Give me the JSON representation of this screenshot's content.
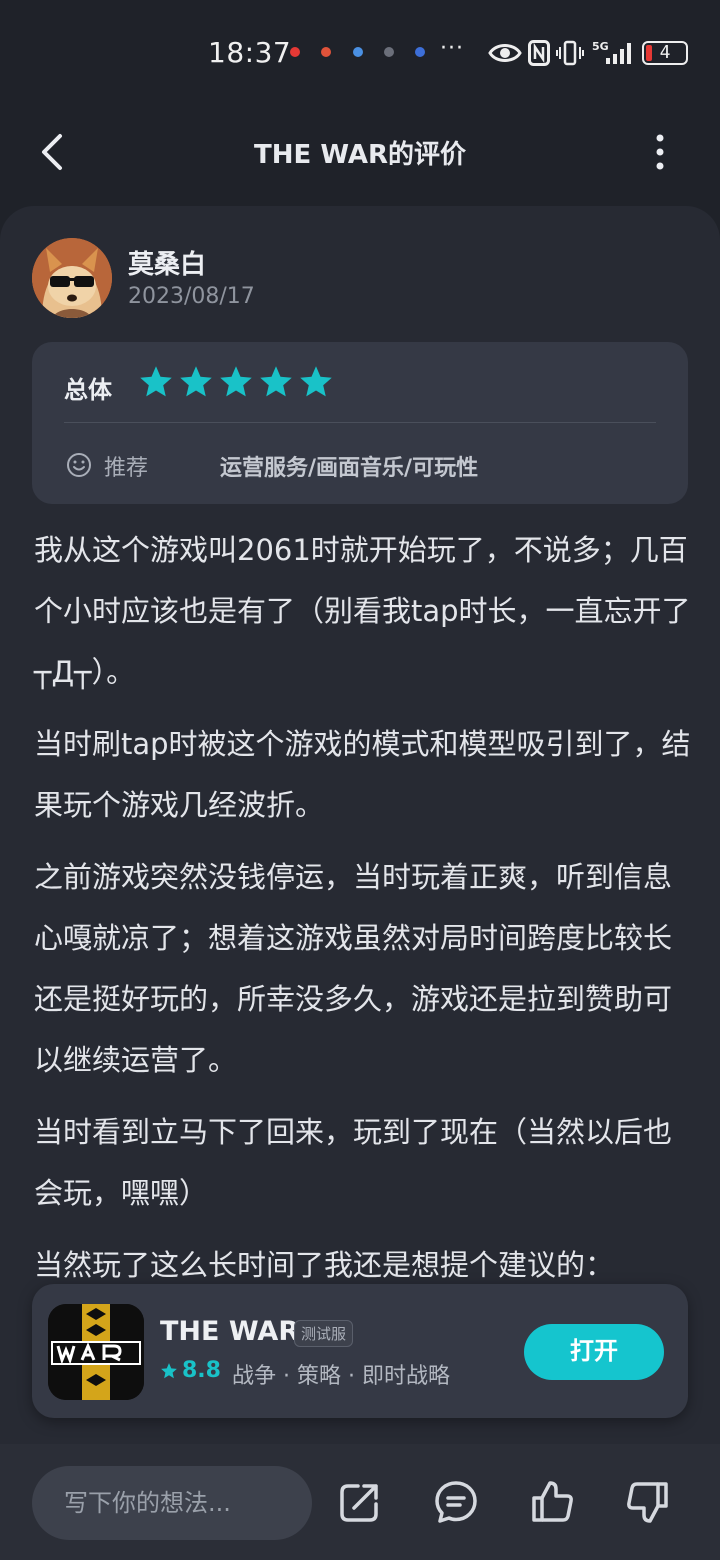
{
  "status_bar": {
    "time": "18:37",
    "more": "···",
    "battery": "4",
    "network": "5G",
    "notification_colors": [
      "#e53935",
      "#e0533a",
      "#4a90e2",
      "#6b6f7a",
      "#3d6fd8"
    ]
  },
  "header": {
    "title": "THE WAR的评价"
  },
  "review": {
    "user_name": "莫桑白",
    "date": "2023/08/17",
    "rating": {
      "overall_label": "总体",
      "stars": 5,
      "max_stars": 5,
      "star_color": "#19c2c8",
      "recommend_label": "推荐",
      "tags": "运营服务/画面音乐/可玩性"
    },
    "paragraphs": [
      "我从这个游戏叫2061时就开始玩了，不说多；几百个小时应该也是有了（别看我tap时长，一直忘开了┬Д┬）。",
      "当时刷tap时被这个游戏的模式和模型吸引到了，结果玩个游戏几经波折。",
      "之前游戏突然没钱停运，当时玩着正爽，听到信息心嘎就凉了；想着这游戏虽然对局时间跨度比较长还是挺好玩的，所幸没多久，游戏还是拉到赞助可以继续运营了。",
      "当时看到立马下了回来，玩到了现在（当然以后也会玩，嘿嘿）",
      "当然玩了这么长时间了我还是想提个建议的："
    ]
  },
  "app_banner": {
    "name": "THE WAR",
    "badge": "测试服",
    "score": "8.8",
    "tags": "战争 · 策略 · 即时战略",
    "open_label": "打开",
    "accent": "#15c5ce"
  },
  "bottom_bar": {
    "input_placeholder": "写下你的想法...",
    "icons": [
      "share-icon",
      "comment-icon",
      "like-icon",
      "dislike-icon"
    ]
  }
}
